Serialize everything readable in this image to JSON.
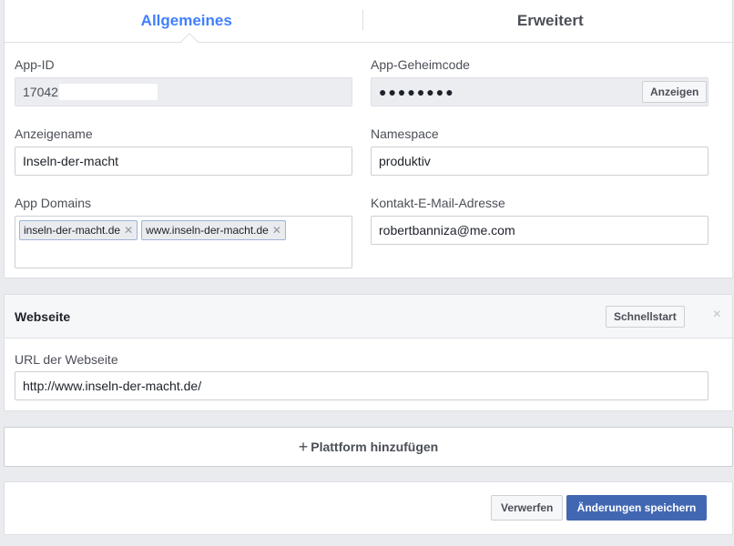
{
  "tabs": [
    {
      "label": "Allgemeines",
      "active": true
    },
    {
      "label": "Erweitert",
      "active": false
    }
  ],
  "general": {
    "app_id_label": "App-ID",
    "app_id_value": "17042",
    "app_secret_label": "App-Geheimcode",
    "app_secret_value": "●●●●●●●●",
    "show_button": "Anzeigen",
    "display_name_label": "Anzeigename",
    "display_name_value": "Inseln-der-macht",
    "namespace_label": "Namespace",
    "namespace_value": "produktiv",
    "app_domains_label": "App Domains",
    "app_domains": [
      "inseln-der-macht.de",
      "www.inseln-der-macht.de"
    ],
    "contact_email_label": "Kontakt-E-Mail-Adresse",
    "contact_email_value": "robertbanniza@me.com"
  },
  "website": {
    "title": "Webseite",
    "quickstart_button": "Schnellstart",
    "close_symbol": "×",
    "url_label": "URL der Webseite",
    "url_value": "http://www.inseln-der-macht.de/"
  },
  "add_platform": {
    "plus": "+",
    "label": "Plattform hinzufügen"
  },
  "footer": {
    "discard_button": "Verwerfen",
    "save_button": "Änderungen speichern"
  },
  "colors": {
    "accent": "#4080ff",
    "primary_button": "#4267b2",
    "background": "#e9ebee"
  }
}
